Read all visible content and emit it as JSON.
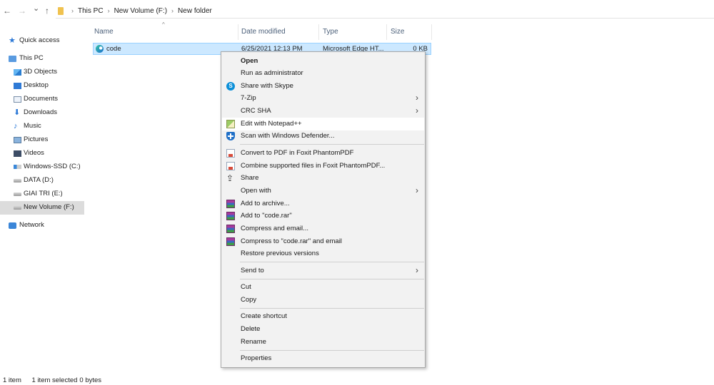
{
  "address_bar": {
    "back_glyph": "←",
    "forward_glyph": "→",
    "recent_glyph": "⌄",
    "up_glyph": "↑",
    "separator_glyph": "›",
    "breadcrumbs": [
      "This PC",
      "New Volume (F:)",
      "New folder"
    ]
  },
  "sidebar": {
    "items": [
      {
        "label": "Quick access",
        "icon": "star-icon"
      },
      {
        "label": "This PC",
        "icon": "computer-icon"
      },
      {
        "label": "3D Objects",
        "icon": "cube-icon"
      },
      {
        "label": "Desktop",
        "icon": "desktop-icon"
      },
      {
        "label": "Documents",
        "icon": "documents-icon"
      },
      {
        "label": "Downloads",
        "icon": "download-icon"
      },
      {
        "label": "Music",
        "icon": "music-icon"
      },
      {
        "label": "Pictures",
        "icon": "pictures-icon"
      },
      {
        "label": "Videos",
        "icon": "videos-icon"
      },
      {
        "label": "Windows-SSD (C:)",
        "icon": "windows-drive-icon"
      },
      {
        "label": "DATA (D:)",
        "icon": "drive-icon"
      },
      {
        "label": "GIAI TRI (E:)",
        "icon": "drive-icon"
      },
      {
        "label": "New Volume (F:)",
        "icon": "drive-icon"
      },
      {
        "label": "Network",
        "icon": "network-icon"
      }
    ]
  },
  "file_list": {
    "sort_glyph": "^",
    "columns": [
      "Name",
      "Date modified",
      "Type",
      "Size"
    ],
    "rows": [
      {
        "name": "code",
        "date": "6/25/2021 12:13 PM",
        "type": "Microsoft Edge HT...",
        "size": "0 KB",
        "icon": "edge-icon"
      }
    ]
  },
  "status_bar": {
    "item_count": "1 item",
    "selection": "1 item selected",
    "size": "0 bytes"
  },
  "context_menu": {
    "submenu_glyph": "›",
    "share_glyph": "⇪",
    "items": [
      {
        "label": "Open"
      },
      {
        "label": "Run as administrator"
      },
      {
        "label": "Share with Skype",
        "icon": "skype-icon",
        "icon_glyph": "S"
      },
      {
        "label": "7-Zip"
      },
      {
        "label": "CRC SHA"
      },
      {
        "label": "Edit with Notepad++",
        "icon": "notepad-plus-plus-icon"
      },
      {
        "label": "Scan with Windows Defender...",
        "icon": "windows-defender-icon"
      },
      {
        "label": "Convert to PDF in Foxit PhantomPDF",
        "icon": "foxit-icon"
      },
      {
        "label": "Combine supported files in Foxit PhantomPDF...",
        "icon": "foxit-icon"
      },
      {
        "label": "Share",
        "icon": "share-icon"
      },
      {
        "label": "Open with"
      },
      {
        "label": "Add to archive...",
        "icon": "winrar-icon"
      },
      {
        "label": "Add to \"code.rar\"",
        "icon": "winrar-icon"
      },
      {
        "label": "Compress and email...",
        "icon": "winrar-icon"
      },
      {
        "label": "Compress to \"code.rar\" and email",
        "icon": "winrar-icon"
      },
      {
        "label": "Restore previous versions"
      },
      {
        "label": "Send to"
      },
      {
        "label": "Cut"
      },
      {
        "label": "Copy"
      },
      {
        "label": "Create shortcut"
      },
      {
        "label": "Delete"
      },
      {
        "label": "Rename"
      },
      {
        "label": "Properties"
      }
    ]
  },
  "colors": {
    "selection_fill": "#cce8ff",
    "selection_border": "#99d1ff",
    "menu_background": "#f2f2f2",
    "accent": "#2b78d6"
  }
}
